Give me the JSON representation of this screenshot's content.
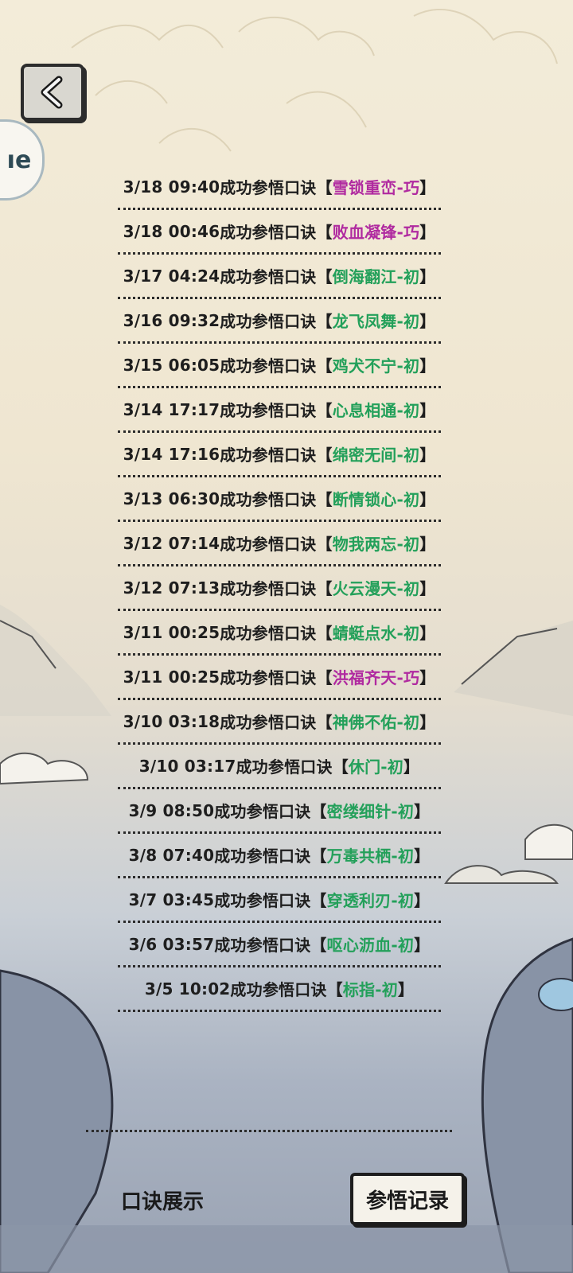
{
  "colors": {
    "green": "#23a05a",
    "purple": "#b02aa0",
    "text": "#1e1e1e"
  },
  "header": {
    "back_icon": "chevron-left-icon",
    "side_badge_text": "ıe"
  },
  "records": [
    {
      "time": "3/18 09:40",
      "prefix": "成功参悟口诀",
      "name": "雪锁重峦-巧",
      "tier": "purple"
    },
    {
      "time": "3/18 00:46",
      "prefix": "成功参悟口诀",
      "name": "败血凝锋-巧",
      "tier": "purple"
    },
    {
      "time": "3/17 04:24",
      "prefix": "成功参悟口诀",
      "name": "倒海翻江-初",
      "tier": "green"
    },
    {
      "time": "3/16 09:32",
      "prefix": "成功参悟口诀",
      "name": "龙飞凤舞-初",
      "tier": "green"
    },
    {
      "time": "3/15 06:05",
      "prefix": "成功参悟口诀",
      "name": "鸡犬不宁-初",
      "tier": "green"
    },
    {
      "time": "3/14 17:17",
      "prefix": "成功参悟口诀",
      "name": "心息相通-初",
      "tier": "green"
    },
    {
      "time": "3/14 17:16",
      "prefix": "成功参悟口诀",
      "name": "绵密无间-初",
      "tier": "green"
    },
    {
      "time": "3/13 06:30",
      "prefix": "成功参悟口诀",
      "name": "断情锁心-初",
      "tier": "green"
    },
    {
      "time": "3/12 07:14",
      "prefix": "成功参悟口诀",
      "name": "物我两忘-初",
      "tier": "green"
    },
    {
      "time": "3/12 07:13",
      "prefix": "成功参悟口诀",
      "name": "火云漫天-初",
      "tier": "green"
    },
    {
      "time": "3/11 00:25",
      "prefix": "成功参悟口诀",
      "name": "蜻蜓点水-初",
      "tier": "green"
    },
    {
      "time": "3/11 00:25",
      "prefix": "成功参悟口诀",
      "name": "洪福齐天-巧",
      "tier": "purple"
    },
    {
      "time": "3/10 03:18",
      "prefix": "成功参悟口诀",
      "name": "神佛不佑-初",
      "tier": "green"
    },
    {
      "time": "3/10 03:17",
      "prefix": "成功参悟口诀",
      "name": "休门-初",
      "tier": "green"
    },
    {
      "time": "3/9 08:50",
      "prefix": "成功参悟口诀",
      "name": "密缕细针-初",
      "tier": "green"
    },
    {
      "time": "3/8 07:40",
      "prefix": "成功参悟口诀",
      "name": "万毒共栖-初",
      "tier": "green"
    },
    {
      "time": "3/7 03:45",
      "prefix": "成功参悟口诀",
      "name": "穿透利刃-初",
      "tier": "green"
    },
    {
      "time": "3/6 03:57",
      "prefix": "成功参悟口诀",
      "name": "呕心沥血-初",
      "tier": "green"
    },
    {
      "time": "3/5 10:02",
      "prefix": "成功参悟口诀",
      "name": "标指-初",
      "tier": "green"
    }
  ],
  "bracket_open": "【",
  "bracket_close": "】",
  "tabs": {
    "left_label": "口诀展示",
    "right_label": "参悟记录"
  }
}
